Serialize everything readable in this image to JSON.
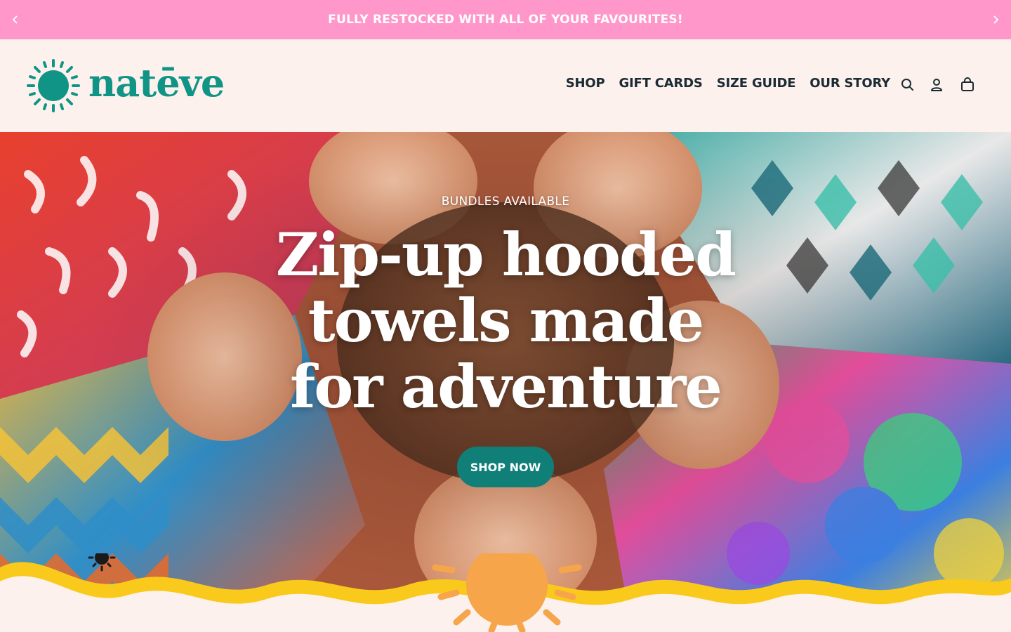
{
  "announcement": {
    "text": "FULLY RESTOCKED WITH ALL OF YOUR FAVOURITES!",
    "prev_icon": "chevron-left-icon",
    "next_icon": "chevron-right-icon"
  },
  "header": {
    "logo_text": "natēve",
    "nav": [
      {
        "label": "SHOP"
      },
      {
        "label": "GIFT CARDS"
      },
      {
        "label": "SIZE GUIDE"
      },
      {
        "label": "OUR STORY"
      }
    ],
    "icons": [
      "search-icon",
      "account-icon",
      "cart-icon"
    ]
  },
  "hero": {
    "eyebrow": "BUNDLES AVAILABLE",
    "headline_lines": [
      "Zip-up hooded",
      "towels made",
      "for adventure"
    ],
    "cta_label": "SHOP NOW"
  },
  "colors": {
    "announcement_bg": "#ff97cb",
    "header_bg": "#fdf1ee",
    "brand_teal": "#109485",
    "cta_bg": "#0f7f78",
    "wave_yellow": "#f9c91c",
    "sun_orange": "#f7a54a"
  }
}
